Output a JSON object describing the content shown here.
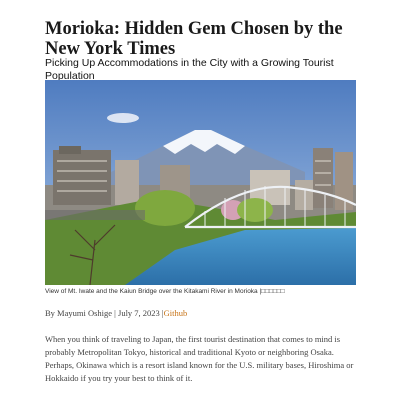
{
  "article": {
    "title": "Morioka: Hidden Gem Chosen by the New York Times",
    "subtitle": "Picking Up Accommodations in the City with a Growing Tourist Population",
    "caption": "View of Mt. Iwate and the Kaiun Bridge over the Kitakami River in Morioka |□□□□□□",
    "byline_prefix": "By Mayumi Oshige | July 7, 2023 |",
    "source_link": "Github",
    "body": "When you think of traveling to Japan, the first tourist destination that comes to mind is probably Metropolitan Tokyo, historical and traditional Kyoto or neighboring Osaka. Perhaps, Okinawa which is a resort island known for the U.S. military bases, Hiroshima or Hokkaido if you try your best to think of it."
  },
  "colors": {
    "link": "#c77316",
    "sky": "#5b84c4",
    "river": "#3a86c0"
  }
}
